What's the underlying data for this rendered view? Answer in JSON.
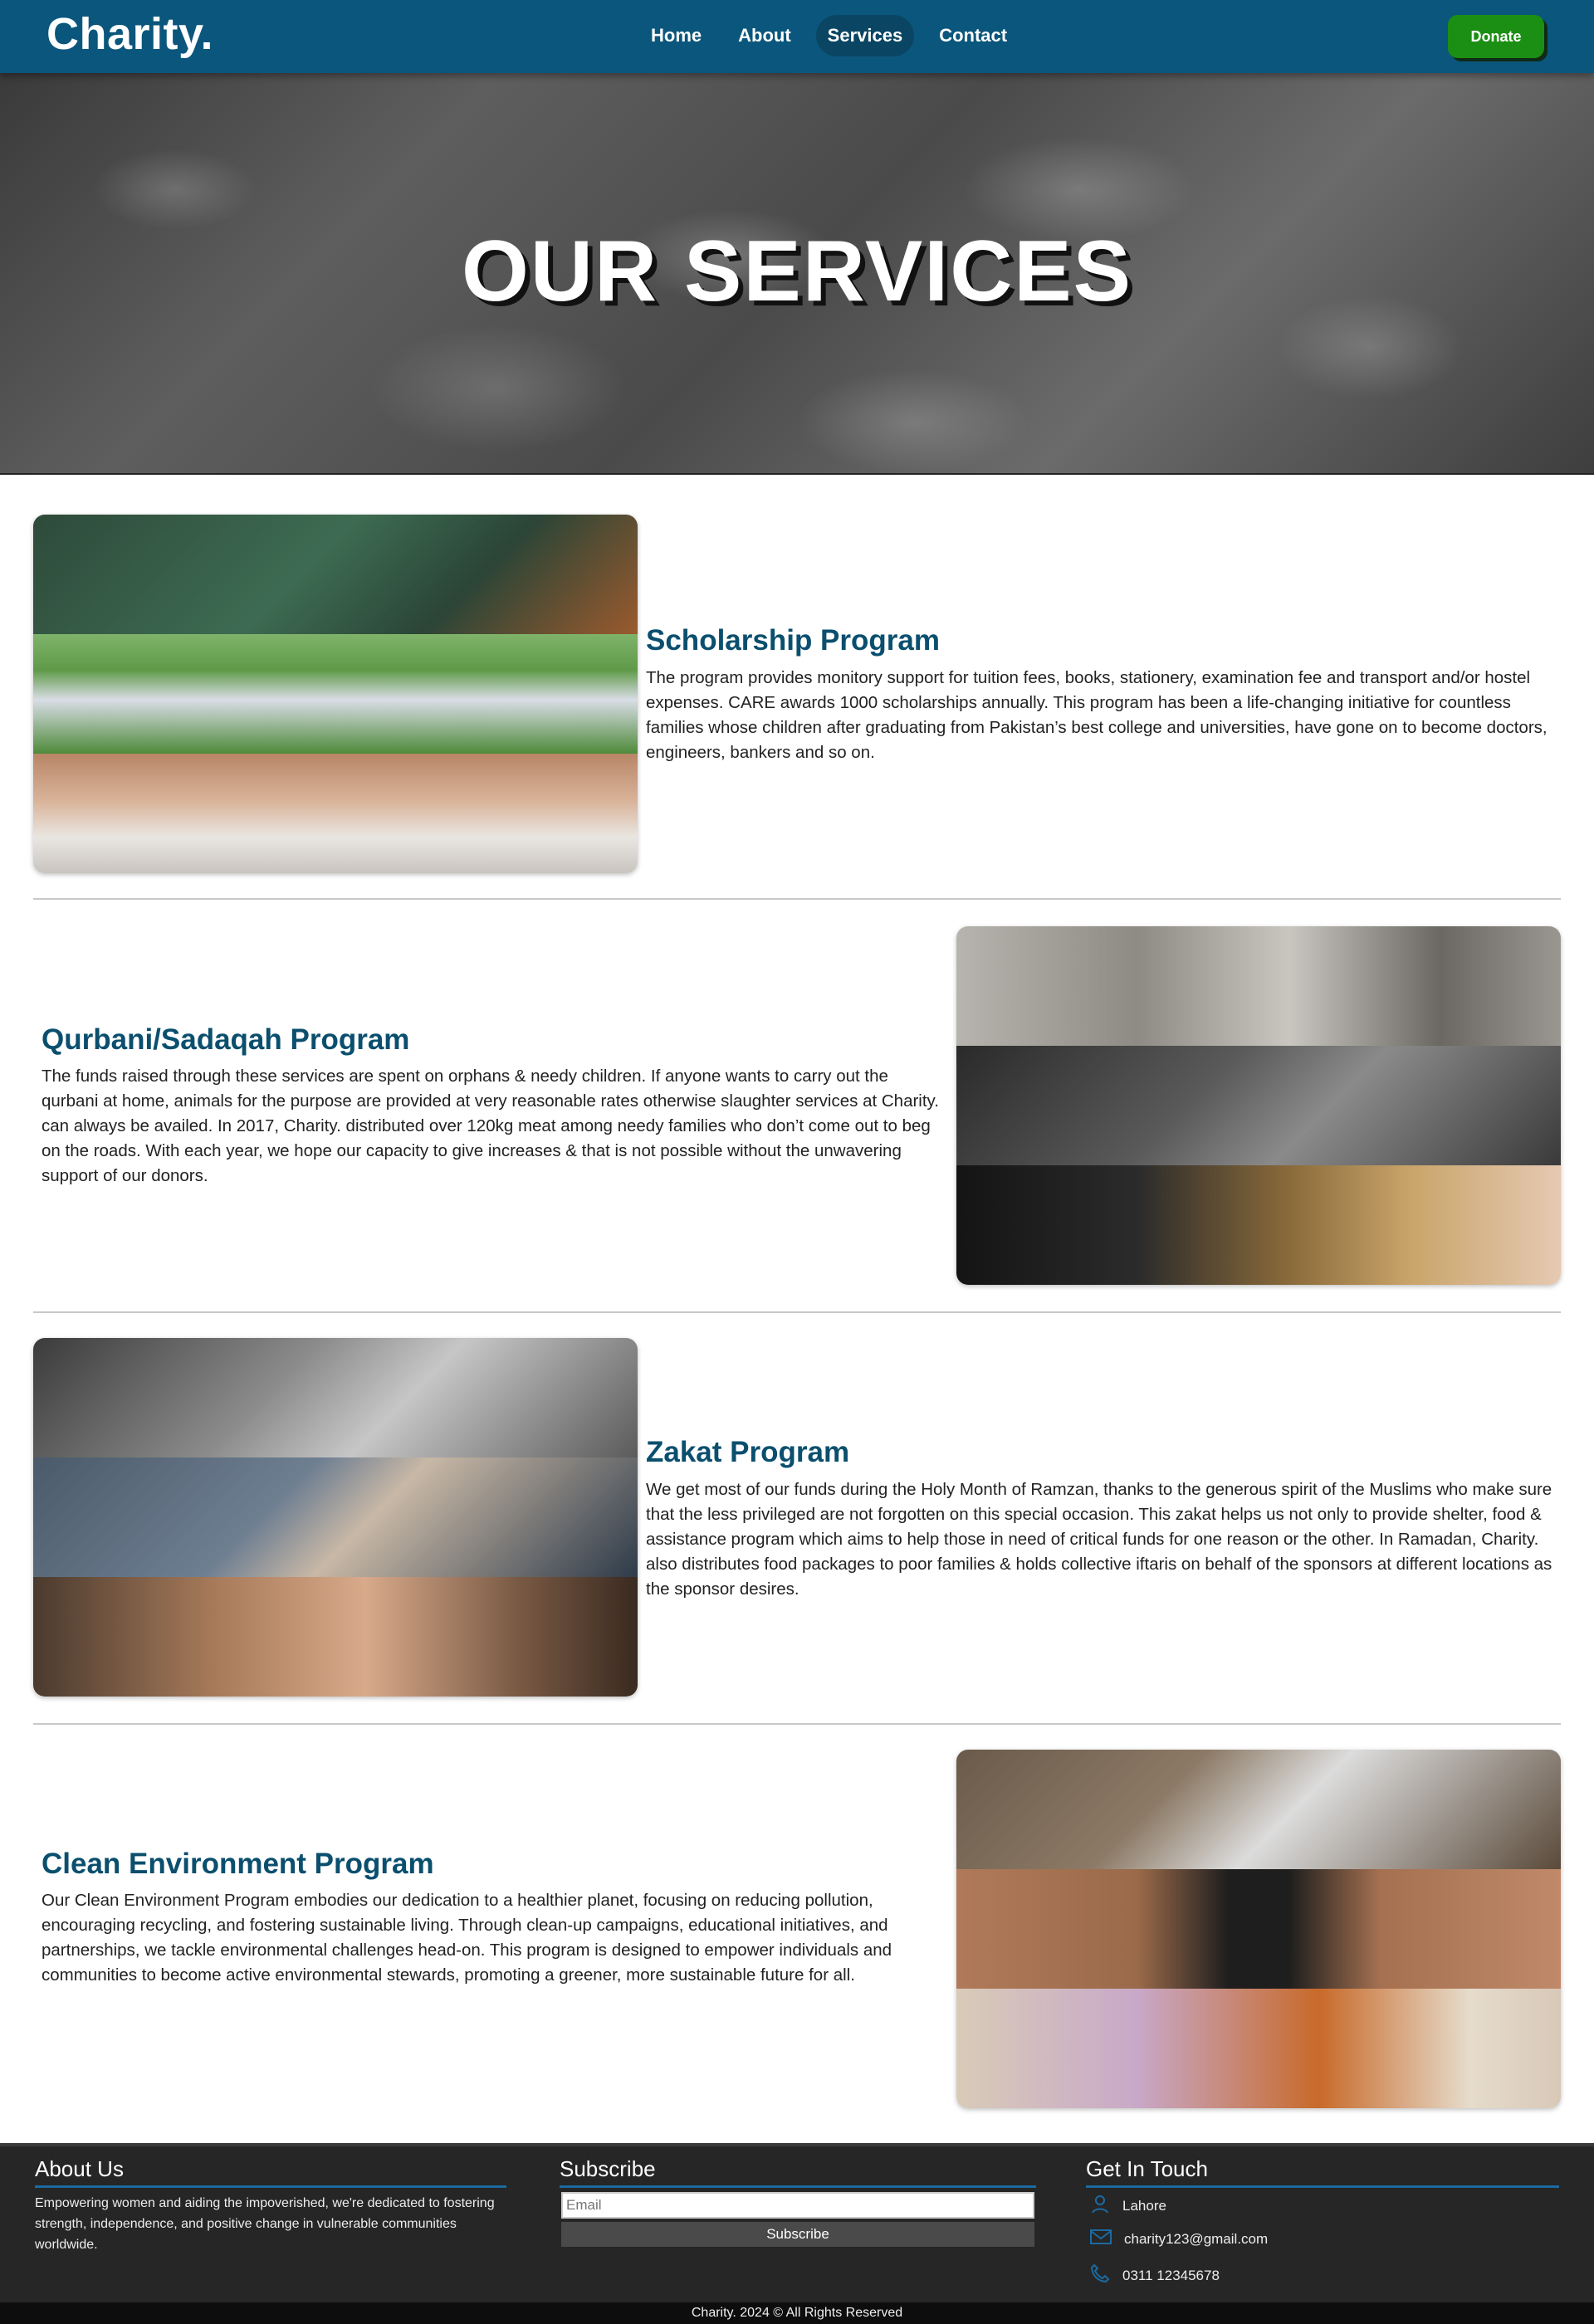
{
  "nav": {
    "brand": "Charity.",
    "items": [
      {
        "label": "Home",
        "active": false
      },
      {
        "label": "About",
        "active": false
      },
      {
        "label": "Services",
        "active": true
      },
      {
        "label": "Contact",
        "active": false
      }
    ],
    "donate_label": "Donate"
  },
  "hero": {
    "title": "OUR SERVICES"
  },
  "services": [
    {
      "title": "Scholarship Program",
      "text": "The program provides monitory support for tuition fees, books, stationery, examination fee and transport and/or hostel expenses. CARE awards 1000 scholarships annually. This program has been a life-changing initiative for countless families whose children after graduating from Pakistan’s best college and universities, have gone on to become doctors, engineers, bankers and so on."
    },
    {
      "title": "Qurbani/Sadaqah Program",
      "text": "The funds raised through these services are spent on orphans & needy children. If anyone wants to carry out the qurbani at home, animals for the purpose are provided at very reasonable rates otherwise slaughter services at Charity. can always be availed. In 2017, Charity. distributed over 120kg meat among needy families who don’t come out to beg on the roads. With each year, we hope our capacity to give increases & that is not possible without the unwavering support of our donors."
    },
    {
      "title": "Zakat Program",
      "text": "We get most of our funds during the Holy Month of Ramzan, thanks to the generous spirit of the Muslims who make sure that the less privileged are not forgotten on this special occasion. This zakat helps us not only to provide shelter, food & assistance program which aims to help those in need of critical funds for one reason or the other. In Ramadan, Charity. also distributes food packages to poor families & holds collective iftaris on behalf of the sponsors at different locations as the sponsor desires."
    },
    {
      "title": "Clean Environment Program",
      "text": "Our Clean Environment Program embodies our dedication to a healthier planet, focusing on reducing pollution, encouraging recycling, and fostering sustainable living. Through clean-up campaigns, educational initiatives, and partnerships, we tackle environmental challenges head-on. This program is designed to empower individuals and communities to become active environmental stewards, promoting a greener, more sustainable future for all."
    }
  ],
  "footer": {
    "about": {
      "heading": "About Us",
      "text": "Empowering women and aiding the impoverished, we're dedicated to fostering strength, independence, and positive change in vulnerable communities worldwide."
    },
    "subscribe": {
      "heading": "Subscribe",
      "placeholder": "Email",
      "button": "Subscribe"
    },
    "contact": {
      "heading": "Get In Touch",
      "location": "Lahore",
      "email": "charity123@gmail.com",
      "phone": "0311 12345678"
    },
    "copyright": "Charity. 2024 © All Rights Reserved"
  },
  "colors": {
    "nav_bg": "#0b567c",
    "title_blue": "#0b4f6e",
    "donate_green": "#1b8f13",
    "footer_bg": "#262626",
    "footer_accent": "#1c6aa0"
  }
}
